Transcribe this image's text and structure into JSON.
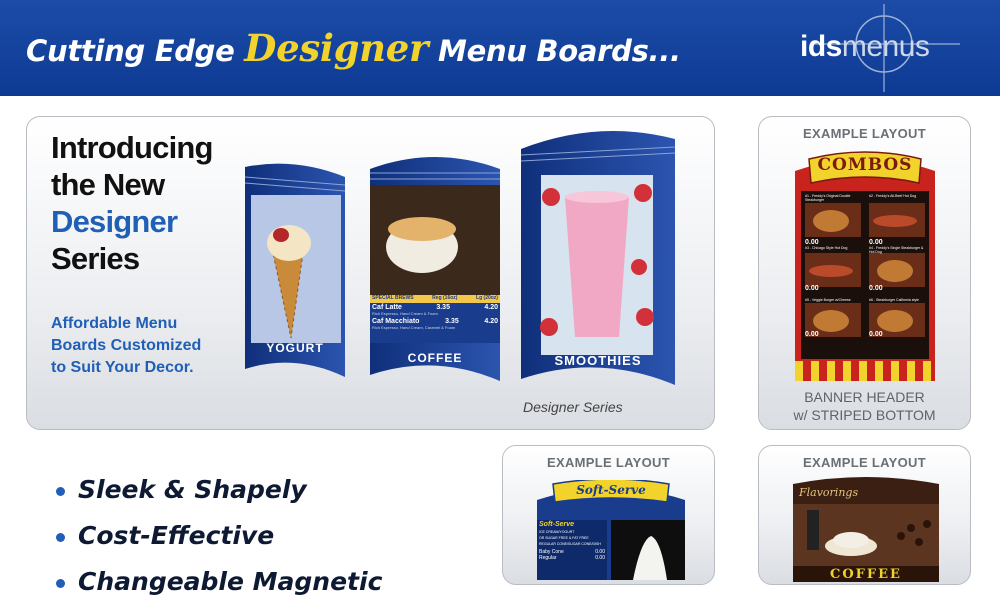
{
  "header": {
    "headline_pre": "Cutting Edge ",
    "headline_accent": "Designer",
    "headline_post": " Menu Boards...",
    "logo_ids": "ids",
    "logo_menus": "menus"
  },
  "intro": {
    "title_line1": "Introducing",
    "title_line2": "the New",
    "title_line3": "Designer",
    "title_line4": "Series",
    "sub_line1": "Affordable Menu",
    "sub_line2": "Boards Customized",
    "sub_line3": "to Suit Your Decor.",
    "caption": "Designer Series",
    "boards": {
      "yogurt": "YOGURT",
      "coffee": "COFFEE",
      "smoothies": "SMOOTHIES",
      "coffee_menu_header": "SPECIAL BREWS",
      "coffee_menu_col1": "Reg (16oz)",
      "coffee_menu_col2": "Lg (20oz)",
      "coffee_item1": "Caf Latte",
      "coffee_item1_reg": "3.35",
      "coffee_item1_lg": "4.20",
      "coffee_item1_desc": "Rich Espresso, Hand Cream & Foam",
      "coffee_item2": "Caf Macchiato",
      "coffee_item2_reg": "3.35",
      "coffee_item2_lg": "4.20",
      "coffee_item2_desc": "Rich Espresso, Hand Cream, Caramel & Foam"
    }
  },
  "examples": [
    {
      "label": "EXAMPLE LAYOUT",
      "banner": "COMBOS",
      "footer_line1": "BANNER HEADER",
      "footer_line2": "w/ STRIPED BOTTOM",
      "prices": [
        "0.00",
        "0.00",
        "0.00",
        "0.00",
        "0.00",
        "0.00"
      ],
      "items": [
        "#1 - Freddy's Original Double Steakburger",
        "#2 - Freddy's All-Beef Hot Dog",
        "#3 - Chicago Style Hot Dog",
        "#4 - Freddy's Single Steakburger & Hot Dog",
        "#5 - Veggie Burger w/Cheese",
        "#6 - Steakburger California style"
      ]
    },
    {
      "label": "EXAMPLE LAYOUT",
      "banner": "Soft-Serve",
      "menu_title": "Soft-Serve",
      "row1": "ICE CREAM/YOGURT",
      "row2": "OR SUGAR FREE & FAT FREE",
      "row3": "REGULAR CONE/SUGAR CONE/DISH",
      "item1": "Baby Cone",
      "item1_price": "0.00",
      "item2": "Regular",
      "item2_price": "0.00"
    },
    {
      "label": "EXAMPLE LAYOUT",
      "banner": "Flavorings",
      "band": "COFFEE"
    }
  ],
  "bullets": [
    "Sleek & Shapely",
    "Cost-Effective",
    "Changeable Magnetic"
  ],
  "colors": {
    "header_blue": "#0d3a93",
    "accent_yellow": "#f2d32b",
    "brand_blue": "#1f5fb6",
    "combo_red": "#c8231c"
  }
}
